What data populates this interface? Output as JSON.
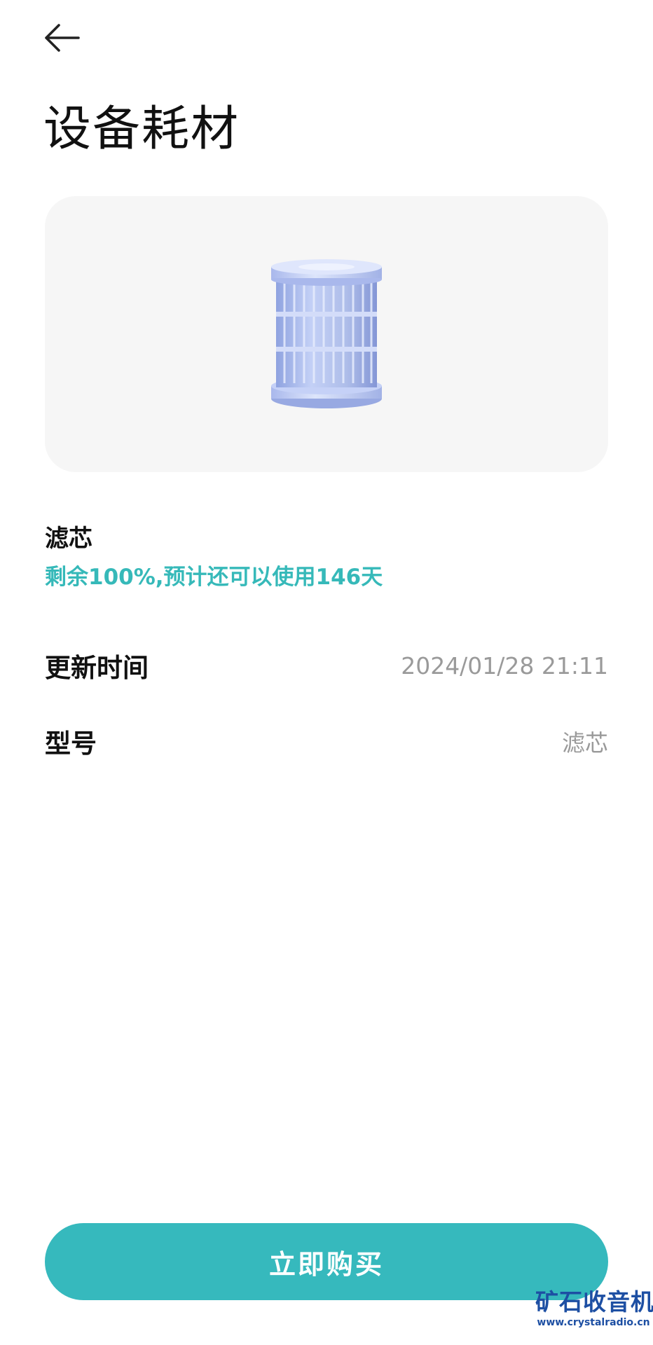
{
  "header": {
    "back_icon": "arrow-left-icon",
    "title": "设备耗材"
  },
  "consumable": {
    "image_icon": "filter-cartridge-image",
    "name": "滤芯",
    "status": "剩余100%,预计还可以使用146天",
    "remaining_percent": 100,
    "remaining_days": 146,
    "status_color": "#36b9b9"
  },
  "details": [
    {
      "label": "更新时间",
      "value": "2024/01/28 21:11"
    },
    {
      "label": "型号",
      "value": "滤芯"
    }
  ],
  "action": {
    "buy_label": "立即购买",
    "button_color": "#36b9bd"
  },
  "watermark": {
    "main": "矿石收音机",
    "sub": "www.crystalradio.cn"
  }
}
